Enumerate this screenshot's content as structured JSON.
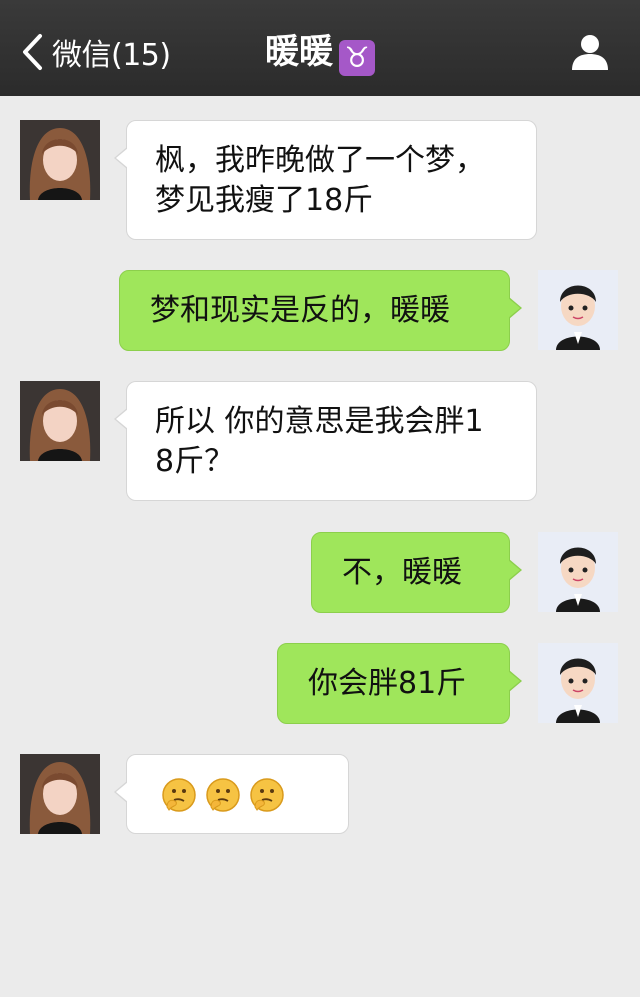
{
  "header": {
    "back_label": "微信(15)",
    "title": "暖暖",
    "title_emoji": "♉",
    "back_icon": "chevron-left-icon",
    "profile_icon": "person-icon"
  },
  "messages": [
    {
      "side": "in",
      "lines": [
        "枫，我昨晚做了一个梦，",
        "梦见我瘦了18斤"
      ]
    },
    {
      "side": "out",
      "lines": [
        "梦和现实是反的，暖暖"
      ]
    },
    {
      "side": "in",
      "lines": [
        "所以 你的意思是我会胖1",
        "8斤？"
      ]
    },
    {
      "side": "out",
      "lines": [
        "不，暖暖"
      ]
    },
    {
      "side": "out",
      "lines": [
        "你会胖81斤"
      ]
    },
    {
      "side": "in",
      "emoji": [
        "thinking-face",
        "thinking-face",
        "thinking-face"
      ]
    }
  ],
  "colors": {
    "outgoing_bubble": "#9fe65b",
    "incoming_bubble": "#ffffff",
    "header": "#2f2f2f",
    "background": "#ebebeb",
    "taurus_badge": "#a558c8"
  }
}
